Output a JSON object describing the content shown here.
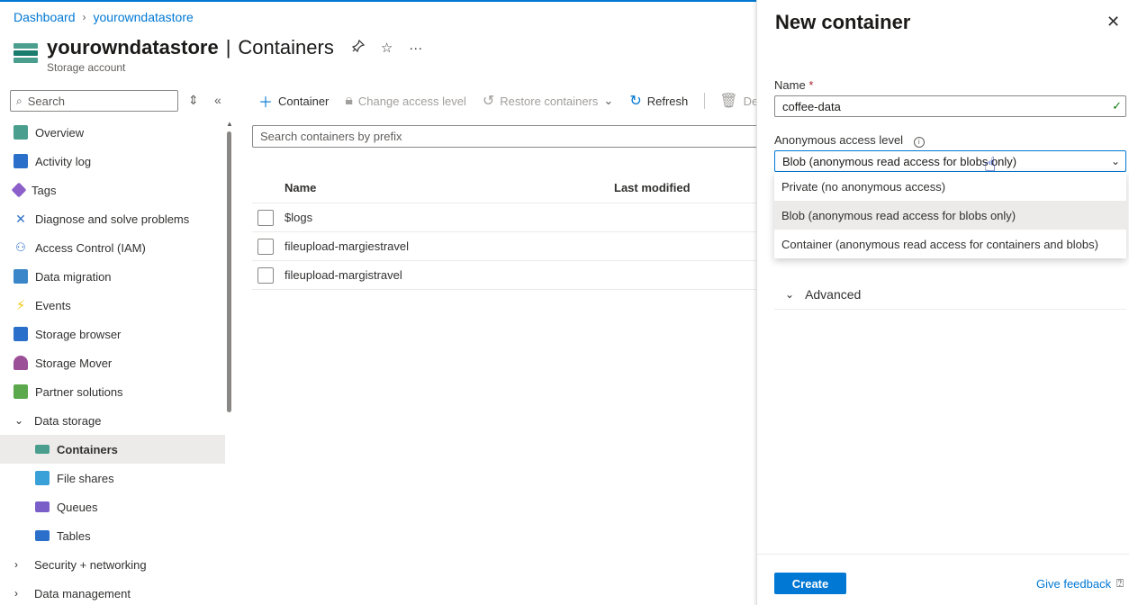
{
  "breadcrumb": {
    "home": "Dashboard",
    "current": "yourowndatastore"
  },
  "header": {
    "resource_name": "yourowndatastore",
    "separator": "|",
    "page": "Containers",
    "subtitle": "Storage account"
  },
  "sidebar": {
    "search_placeholder": "Search",
    "items": [
      {
        "label": "Overview",
        "icon": "overview-icon"
      },
      {
        "label": "Activity log",
        "icon": "activity-log-icon"
      },
      {
        "label": "Tags",
        "icon": "tag-icon"
      },
      {
        "label": "Diagnose and solve problems",
        "icon": "wrench-icon"
      },
      {
        "label": "Access Control (IAM)",
        "icon": "people-icon"
      },
      {
        "label": "Data migration",
        "icon": "migration-icon"
      },
      {
        "label": "Events",
        "icon": "lightning-icon"
      },
      {
        "label": "Storage browser",
        "icon": "storage-browser-icon"
      },
      {
        "label": "Storage Mover",
        "icon": "storage-mover-icon"
      },
      {
        "label": "Partner solutions",
        "icon": "partner-icon"
      }
    ],
    "group_data_storage": "Data storage",
    "sub_items": [
      {
        "label": "Containers",
        "icon": "containers-icon"
      },
      {
        "label": "File shares",
        "icon": "file-shares-icon"
      },
      {
        "label": "Queues",
        "icon": "queues-icon"
      },
      {
        "label": "Tables",
        "icon": "tables-icon"
      }
    ],
    "group_security": "Security + networking",
    "group_data_mgmt": "Data management"
  },
  "toolbar": {
    "add_container": "Container",
    "change_access": "Change access level",
    "restore": "Restore containers",
    "refresh": "Refresh",
    "delete": "De"
  },
  "filter": {
    "placeholder": "Search containers by prefix"
  },
  "table": {
    "columns": [
      "Name",
      "Last modified"
    ],
    "rows": [
      "$logs",
      "fileupload-margiestravel",
      "fileupload-margistravel"
    ]
  },
  "panel": {
    "title": "New container",
    "name_label": "Name",
    "required_mark": "*",
    "name_value": "coffee-data",
    "access_label": "Anonymous access level",
    "access_selected": "Blob (anonymous read access for blobs only)",
    "options": [
      "Private (no anonymous access)",
      "Blob (anonymous read access for blobs only)",
      "Container (anonymous read access for containers and blobs)"
    ],
    "advanced": "Advanced",
    "create": "Create",
    "feedback": "Give feedback"
  },
  "colors": {
    "accent": "#0078d4",
    "selected_bg": "#edebe9",
    "success": "#107c10"
  }
}
